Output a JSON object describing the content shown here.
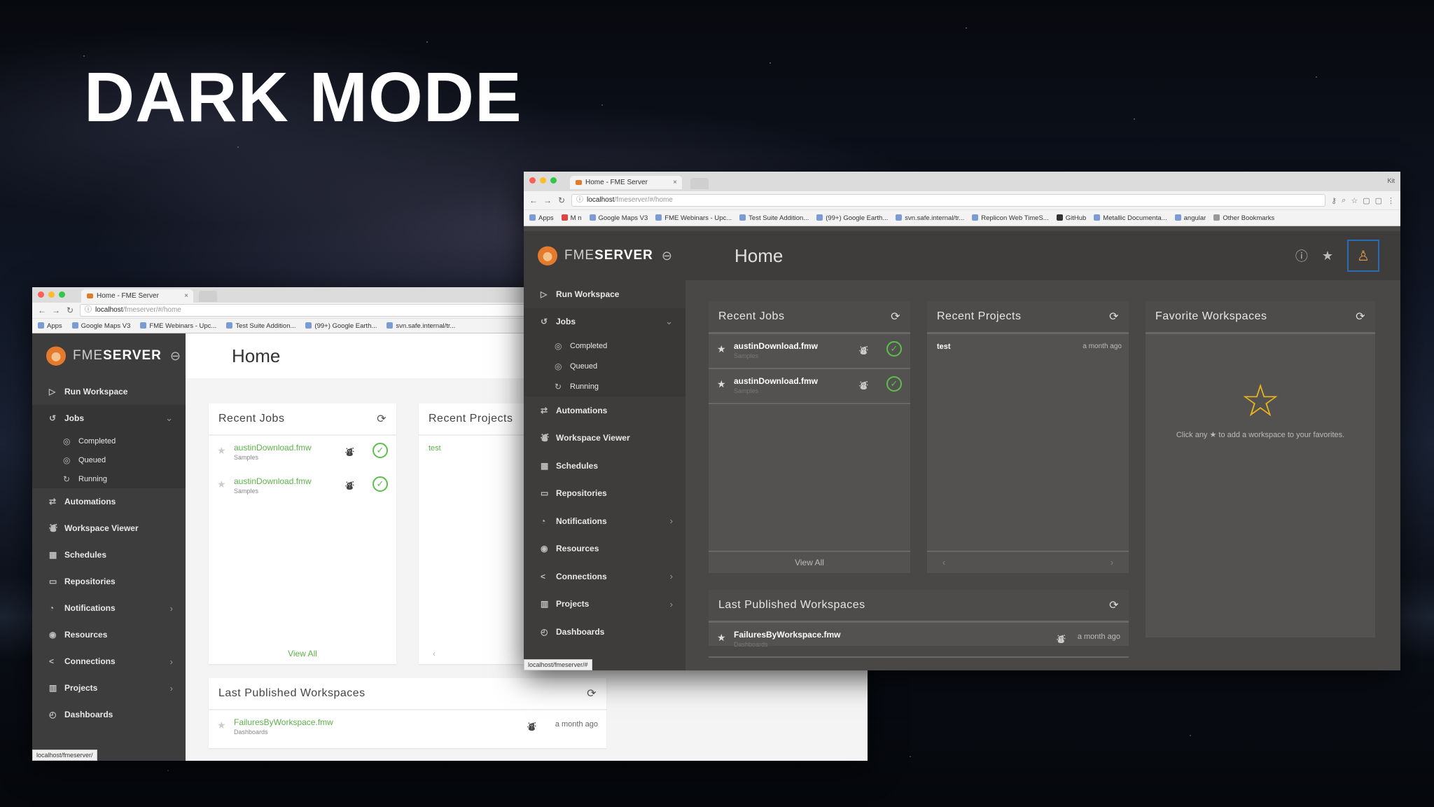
{
  "slide": {
    "title": "DARK MODE"
  },
  "browser": {
    "tab_title": "Home - FME Server",
    "user": "Kit",
    "url_host": "localhost",
    "url_path": "/fmeserver/#/home",
    "bookmarks_light": [
      "Apps",
      "Google Maps V3",
      "FME Webinars - Upc...",
      "Test Suite Addition...",
      "(99+) Google Earth...",
      "svn.safe.internal/tr..."
    ],
    "bookmarks_dark": [
      "Apps",
      "M n",
      "Google Maps V3",
      "FME Webinars - Upc...",
      "Test Suite Addition...",
      "(99+) Google Earth...",
      "svn.safe.internal/tr...",
      "Replicon Web TimeS...",
      "GitHub",
      "Metallic Documenta...",
      "angular",
      "Other Bookmarks"
    ],
    "status_url_light": "localhost/fmeserver/",
    "status_url_dark": "localhost/fmeserver/#"
  },
  "app": {
    "logo_prefix": "FME",
    "logo_suffix": "SERVER",
    "page_title": "Home"
  },
  "nav": {
    "run_workspace": "Run Workspace",
    "jobs": "Jobs",
    "completed": "Completed",
    "queued": "Queued",
    "running": "Running",
    "automations": "Automations",
    "workspace_viewer": "Workspace Viewer",
    "schedules": "Schedules",
    "repositories": "Repositories",
    "notifications": "Notifications",
    "resources": "Resources",
    "connections": "Connections",
    "projects": "Projects",
    "dashboards": "Dashboards"
  },
  "recent_jobs": {
    "title": "Recent Jobs",
    "items": [
      {
        "name": "austinDownload.fmw",
        "repo": "Samples"
      },
      {
        "name": "austinDownload.fmw",
        "repo": "Samples"
      }
    ],
    "view_all": "View All"
  },
  "recent_projects": {
    "title": "Recent Projects",
    "items": [
      {
        "name": "test",
        "time": "a month ago"
      }
    ]
  },
  "favorites": {
    "title": "Favorite Workspaces",
    "hint": "Click any ★ to add a workspace to your favorites."
  },
  "last_published": {
    "title": "Last Published Workspaces",
    "items": [
      {
        "name": "FailuresByWorkspace.fmw",
        "repo": "Dashboards",
        "time": "a month ago"
      }
    ]
  },
  "colors": {
    "accent_green": "#5db04a",
    "star_yellow": "#e8b51a",
    "avatar_border": "#2a6cb3"
  }
}
